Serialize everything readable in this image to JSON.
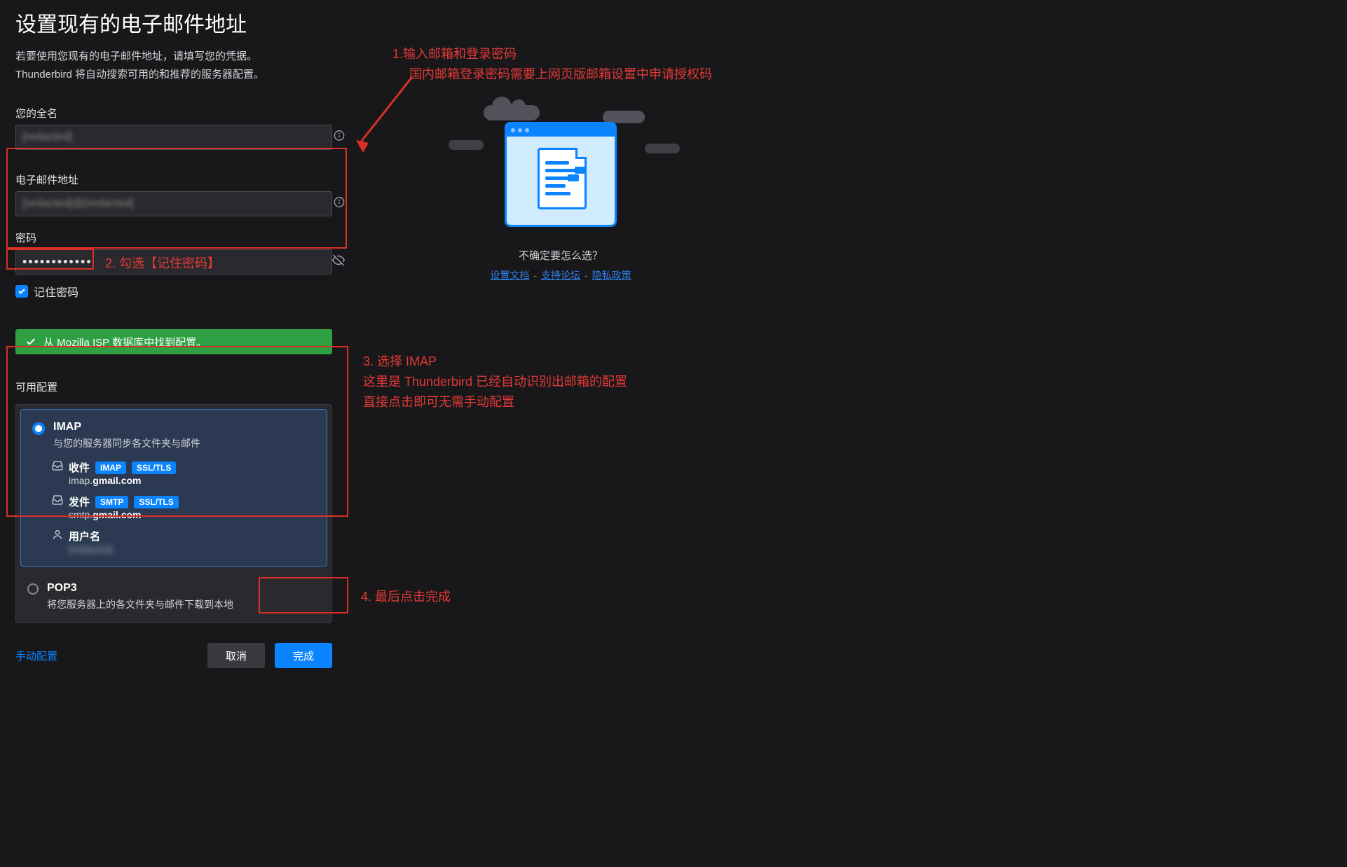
{
  "header": {
    "title": "设置现有的电子邮件地址",
    "sub1": "若要使用您现有的电子邮件地址，请填写您的凭据。",
    "sub2": "Thunderbird 将自动搜索可用的和推荐的服务器配置。"
  },
  "fields": {
    "fullname_label": "您的全名",
    "fullname_value": "[redacted]",
    "email_label": "电子邮件地址",
    "email_value": "[redacted]@[redacted]",
    "password_label": "密码",
    "password_value": "••••••••••••",
    "remember_label": "记住密码"
  },
  "success_msg": "从 Mozilla ISP 数据库中找到配置。",
  "avail_title": "可用配置",
  "imap": {
    "title": "IMAP",
    "desc": "与您的服务器同步各文件夹与邮件",
    "incoming_label": "收件",
    "incoming_proto": "IMAP",
    "incoming_sec": "SSL/TLS",
    "incoming_host_pre": "imap.",
    "incoming_host_b": "gmail.com",
    "outgoing_label": "发件",
    "outgoing_proto": "SMTP",
    "outgoing_sec": "SSL/TLS",
    "outgoing_host_pre": "smtp.",
    "outgoing_host_b": "gmail.com",
    "user_label": "用户名",
    "user_value": "[redacted]"
  },
  "pop3": {
    "title": "POP3",
    "desc": "将您服务器上的各文件夹与邮件下载到本地"
  },
  "buttons": {
    "manual": "手动配置",
    "cancel": "取消",
    "done": "完成"
  },
  "help": {
    "unsure": "不确定要怎么选？",
    "link1": "设置文档",
    "link2": "支持论坛",
    "link3": "隐私政策"
  },
  "anno": {
    "a1_l1": "1.输入邮箱和登录密码",
    "a1_l2": "国内邮箱登录密码需要上网页版邮箱设置中申请授权码",
    "a2": "2. 勾选【记住密码】",
    "a3_l1": "3. 选择 IMAP",
    "a3_l2": "这里是 Thunderbird 已经自动识别出邮箱的配置",
    "a3_l3": "直接点击即可无需手动配置",
    "a4": "4. 最后点击完成"
  }
}
